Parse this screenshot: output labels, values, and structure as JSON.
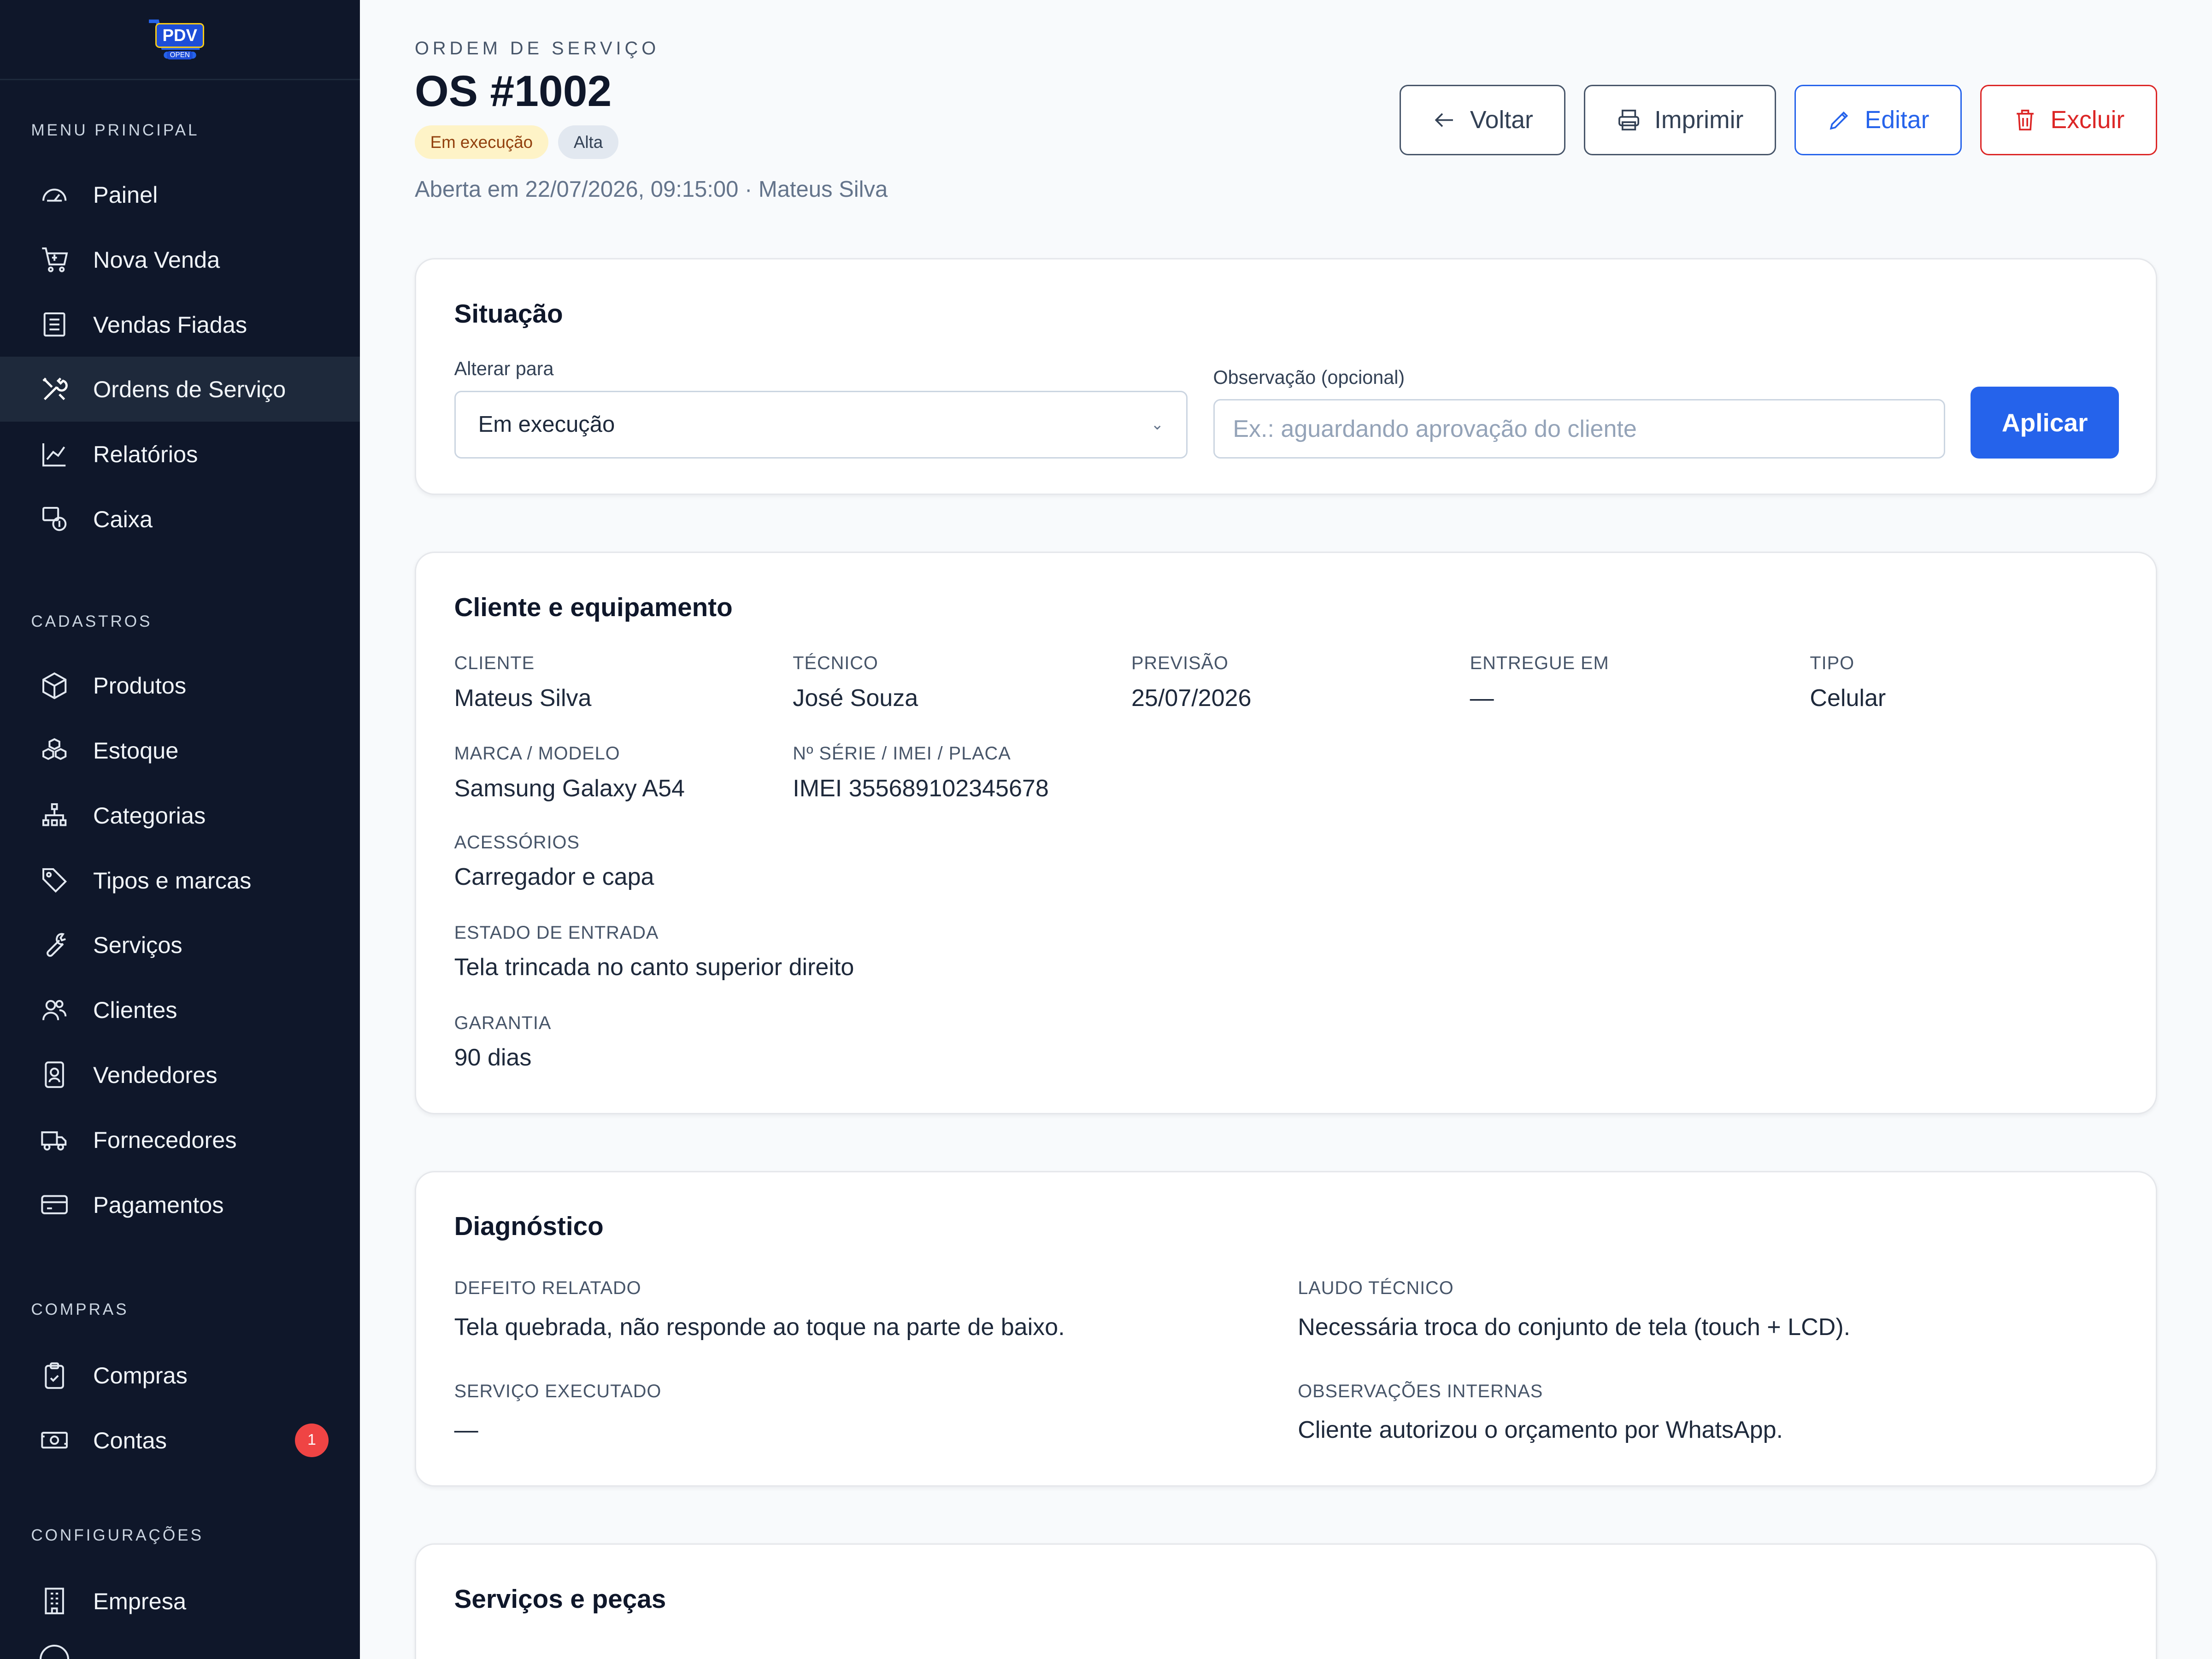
{
  "brand": {
    "logo_text": "PDV",
    "logo_sub": "OPEN"
  },
  "sidebar": {
    "sections": [
      {
        "title": "MENU PRINCIPAL",
        "items": [
          {
            "label": "Painel",
            "icon": "gauge-icon"
          },
          {
            "label": "Nova Venda",
            "icon": "cart-icon"
          },
          {
            "label": "Vendas Fiadas",
            "icon": "receipt-icon"
          },
          {
            "label": "Ordens de Serviço",
            "icon": "tools-icon",
            "active": true
          },
          {
            "label": "Relatórios",
            "icon": "chart-icon"
          },
          {
            "label": "Caixa",
            "icon": "cash-register-icon"
          }
        ]
      },
      {
        "title": "CADASTROS",
        "items": [
          {
            "label": "Produtos",
            "icon": "box-icon"
          },
          {
            "label": "Estoque",
            "icon": "stock-icon"
          },
          {
            "label": "Categorias",
            "icon": "hierarchy-icon"
          },
          {
            "label": "Tipos e marcas",
            "icon": "tag-icon"
          },
          {
            "label": "Serviços",
            "icon": "wrench-icon"
          },
          {
            "label": "Clientes",
            "icon": "users-icon"
          },
          {
            "label": "Vendedores",
            "icon": "id-badge-icon"
          },
          {
            "label": "Fornecedores",
            "icon": "truck-icon"
          },
          {
            "label": "Pagamentos",
            "icon": "card-icon"
          }
        ]
      },
      {
        "title": "COMPRAS",
        "items": [
          {
            "label": "Compras",
            "icon": "clipboard-icon"
          },
          {
            "label": "Contas",
            "icon": "money-icon",
            "badge": "1"
          }
        ]
      },
      {
        "title": "CONFIGURAÇÕES",
        "items": [
          {
            "label": "Empresa",
            "icon": "building-icon"
          }
        ]
      }
    ]
  },
  "header": {
    "eyebrow": "ORDEM DE SERVIÇO",
    "title": "OS #1002",
    "status_chip": "Em execução",
    "priority_chip": "Alta",
    "opened_line": "Aberta em 22/07/2026, 09:15:00 · Mateus Silva",
    "buttons": {
      "back": "Voltar",
      "print": "Imprimir",
      "edit": "Editar",
      "delete": "Excluir"
    }
  },
  "status_card": {
    "title": "Situação",
    "change_label": "Alterar para",
    "change_value": "Em execução",
    "note_label": "Observação (opcional)",
    "note_placeholder": "Ex.: aguardando aprovação do cliente",
    "apply_label": "Aplicar"
  },
  "client_card": {
    "title": "Cliente e equipamento",
    "cliente_label": "CLIENTE",
    "cliente": "Mateus Silva",
    "tecnico_label": "TÉCNICO",
    "tecnico": "José Souza",
    "previsao_label": "PREVISÃO",
    "previsao": "25/07/2026",
    "entregue_label": "ENTREGUE EM",
    "entregue": "—",
    "tipo_label": "TIPO",
    "tipo": "Celular",
    "marca_label": "MARCA / MODELO",
    "marca": "Samsung Galaxy A54",
    "serie_label": "Nº SÉRIE / IMEI / PLACA",
    "serie": "IMEI 355689102345678",
    "acessorios_label": "ACESSÓRIOS",
    "acessorios": "Carregador e capa",
    "estado_label": "ESTADO DE ENTRADA",
    "estado": "Tela trincada no canto superior direito",
    "garantia_label": "GARANTIA",
    "garantia": "90 dias"
  },
  "diag_card": {
    "title": "Diagnóstico",
    "defeito_label": "DEFEITO RELATADO",
    "defeito": "Tela quebrada, não responde ao toque na parte de baixo.",
    "laudo_label": "LAUDO TÉCNICO",
    "laudo": "Necessária troca do conjunto de tela (touch + LCD).",
    "servico_label": "SERVIÇO EXECUTADO",
    "servico": "—",
    "obs_label": "OBSERVAÇÕES INTERNAS",
    "obs": "Cliente autorizou o orçamento por WhatsApp."
  },
  "parts_card": {
    "title": "Serviços e peças"
  },
  "colors": {
    "sidebar_bg": "#0f172a",
    "accent": "#2563eb",
    "danger": "#dc2626",
    "status_bg": "#fef3c7"
  }
}
